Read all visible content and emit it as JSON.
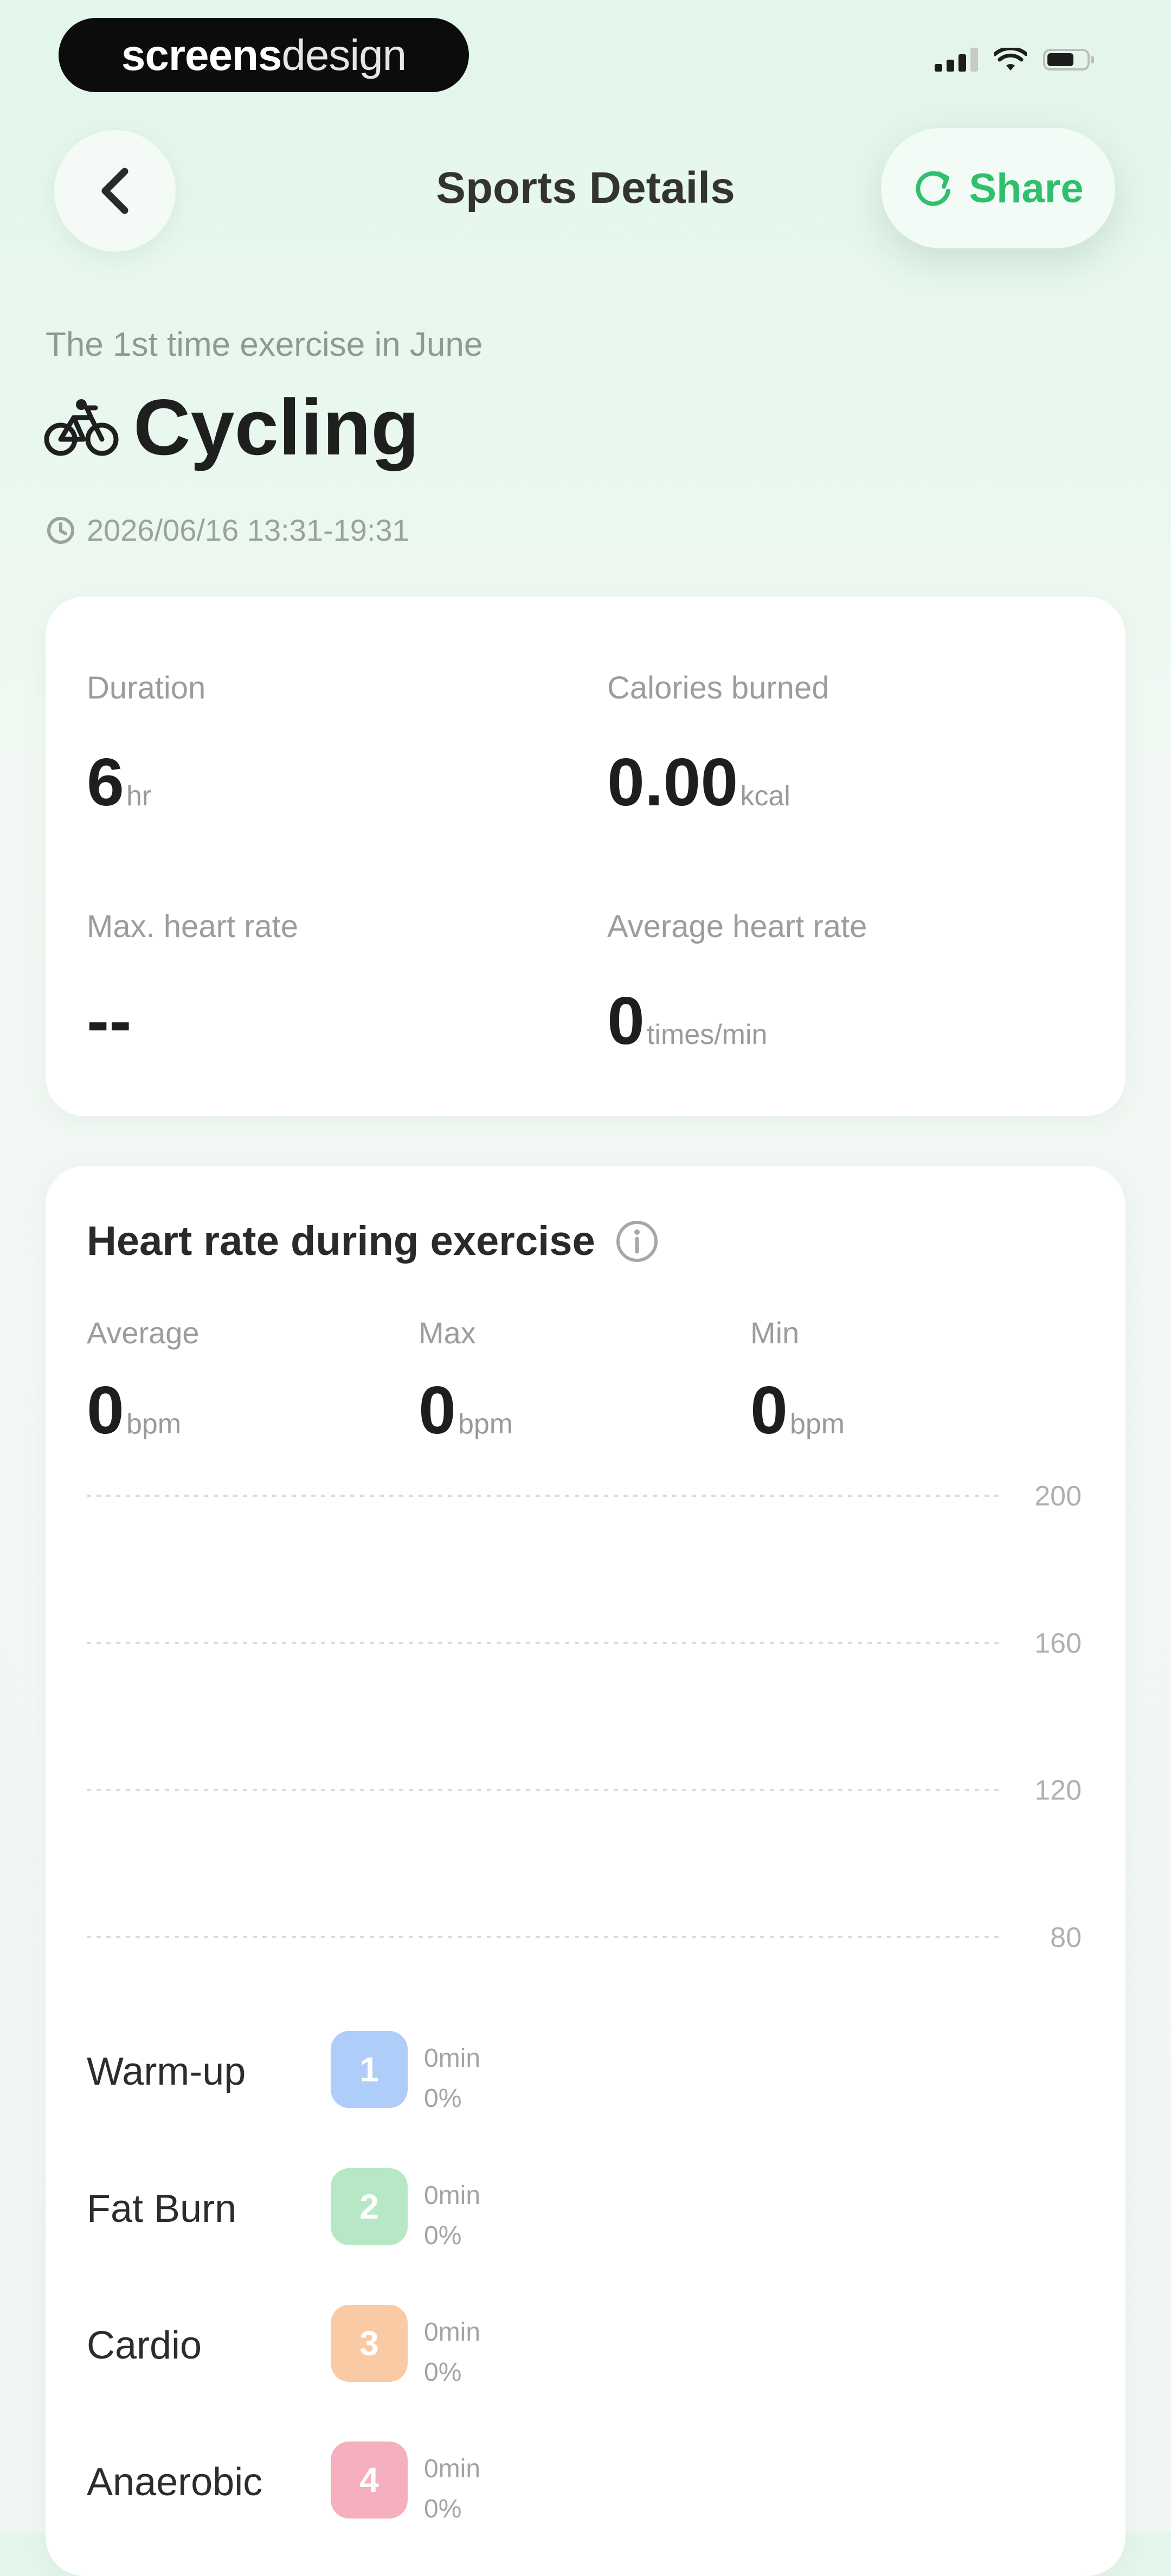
{
  "status_bar": {
    "watermark_bold": "screens",
    "watermark_light": "design",
    "signal_icon": "cellular-signal-icon",
    "wifi_icon": "wifi-icon",
    "battery_icon": "battery-icon"
  },
  "header": {
    "back_icon": "chevron-left-icon",
    "title": "Sports Details",
    "share_label": "Share",
    "share_icon": "share-refresh-icon"
  },
  "workout": {
    "subtitle": "The 1st time exercise in June",
    "sport": "Cycling",
    "sport_icon": "bicycle-icon",
    "time_icon": "clock-icon",
    "time_range": "2026/06/16 13:31-19:31"
  },
  "stats": [
    {
      "label": "Duration",
      "value": "6",
      "unit": "hr"
    },
    {
      "label": "Calories burned",
      "value": "0.00",
      "unit": "kcal"
    },
    {
      "label": "Max. heart rate",
      "value": "--",
      "unit": ""
    },
    {
      "label": "Average heart rate",
      "value": "0",
      "unit": "times/min"
    }
  ],
  "heart_rate": {
    "title": "Heart rate during exercise",
    "info_icon": "info-icon",
    "summary": [
      {
        "label": "Average",
        "value": "0",
        "unit": "bpm"
      },
      {
        "label": "Max",
        "value": "0",
        "unit": "bpm"
      },
      {
        "label": "Min",
        "value": "0",
        "unit": "bpm"
      }
    ],
    "zones": [
      {
        "name": "Warm-up",
        "number": "1",
        "duration": "0min",
        "percent": "0%",
        "color": "#aecdf8"
      },
      {
        "name": "Fat Burn",
        "number": "2",
        "duration": "0min",
        "percent": "0%",
        "color": "#b7e8c6"
      },
      {
        "name": "Cardio",
        "number": "3",
        "duration": "0min",
        "percent": "0%",
        "color": "#f9caa4"
      },
      {
        "name": "Anaerobic",
        "number": "4",
        "duration": "0min",
        "percent": "0%",
        "color": "#f6afbf"
      }
    ]
  },
  "chart_data": {
    "type": "line",
    "title": "",
    "xlabel": "",
    "ylabel": "",
    "ylim": [
      80,
      200
    ],
    "y_ticks": [
      "200",
      "160",
      "120",
      "80"
    ],
    "grid": true,
    "series": []
  },
  "colors": {
    "accent": "#2fc06d",
    "background_top": "#e3f6ea",
    "card": "#ffffff"
  }
}
